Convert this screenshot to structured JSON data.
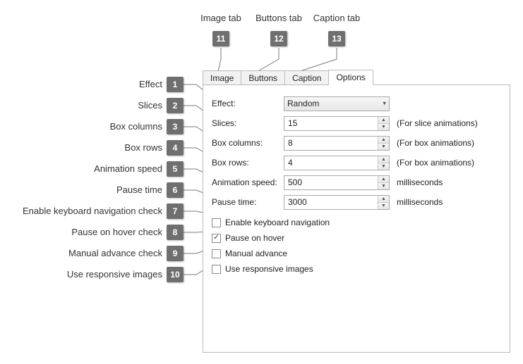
{
  "tabs": {
    "image": "Image",
    "buttons": "Buttons",
    "caption": "Caption",
    "options": "Options"
  },
  "form": {
    "effect": {
      "label": "Effect:",
      "value": "Random"
    },
    "slices": {
      "label": "Slices:",
      "value": "15",
      "suffix": "(For slice animations)"
    },
    "boxcols": {
      "label": "Box columns:",
      "value": "8",
      "suffix": "(For box animations)"
    },
    "boxrows": {
      "label": "Box rows:",
      "value": "4",
      "suffix": "(For box animations)"
    },
    "anispeed": {
      "label": "Animation speed:",
      "value": "500",
      "suffix": "milliseconds"
    },
    "pausetime": {
      "label": "Pause time:",
      "value": "3000",
      "suffix": "milliseconds"
    }
  },
  "checks": {
    "enablekb": {
      "label": "Enable keyboard navigation",
      "checked": false
    },
    "pausehover": {
      "label": "Pause on hover",
      "checked": true
    },
    "manualadv": {
      "label": "Manual advance",
      "checked": false
    },
    "responsive": {
      "label": "Use responsive images",
      "checked": false
    }
  },
  "callouts": {
    "c1": {
      "num": "1",
      "label": "Effect"
    },
    "c2": {
      "num": "2",
      "label": "Slices"
    },
    "c3": {
      "num": "3",
      "label": "Box columns"
    },
    "c4": {
      "num": "4",
      "label": "Box rows"
    },
    "c5": {
      "num": "5",
      "label": "Animation speed"
    },
    "c6": {
      "num": "6",
      "label": "Pause time"
    },
    "c7": {
      "num": "7",
      "label": "Enable keyboard navigation check"
    },
    "c8": {
      "num": "8",
      "label": "Pause on hover check"
    },
    "c9": {
      "num": "9",
      "label": "Manual advance check"
    },
    "c10": {
      "num": "10",
      "label": "Use responsive images"
    },
    "c11": {
      "num": "11",
      "label": "Image tab"
    },
    "c12": {
      "num": "12",
      "label": "Buttons tab"
    },
    "c13": {
      "num": "13",
      "label": "Caption tab"
    }
  }
}
